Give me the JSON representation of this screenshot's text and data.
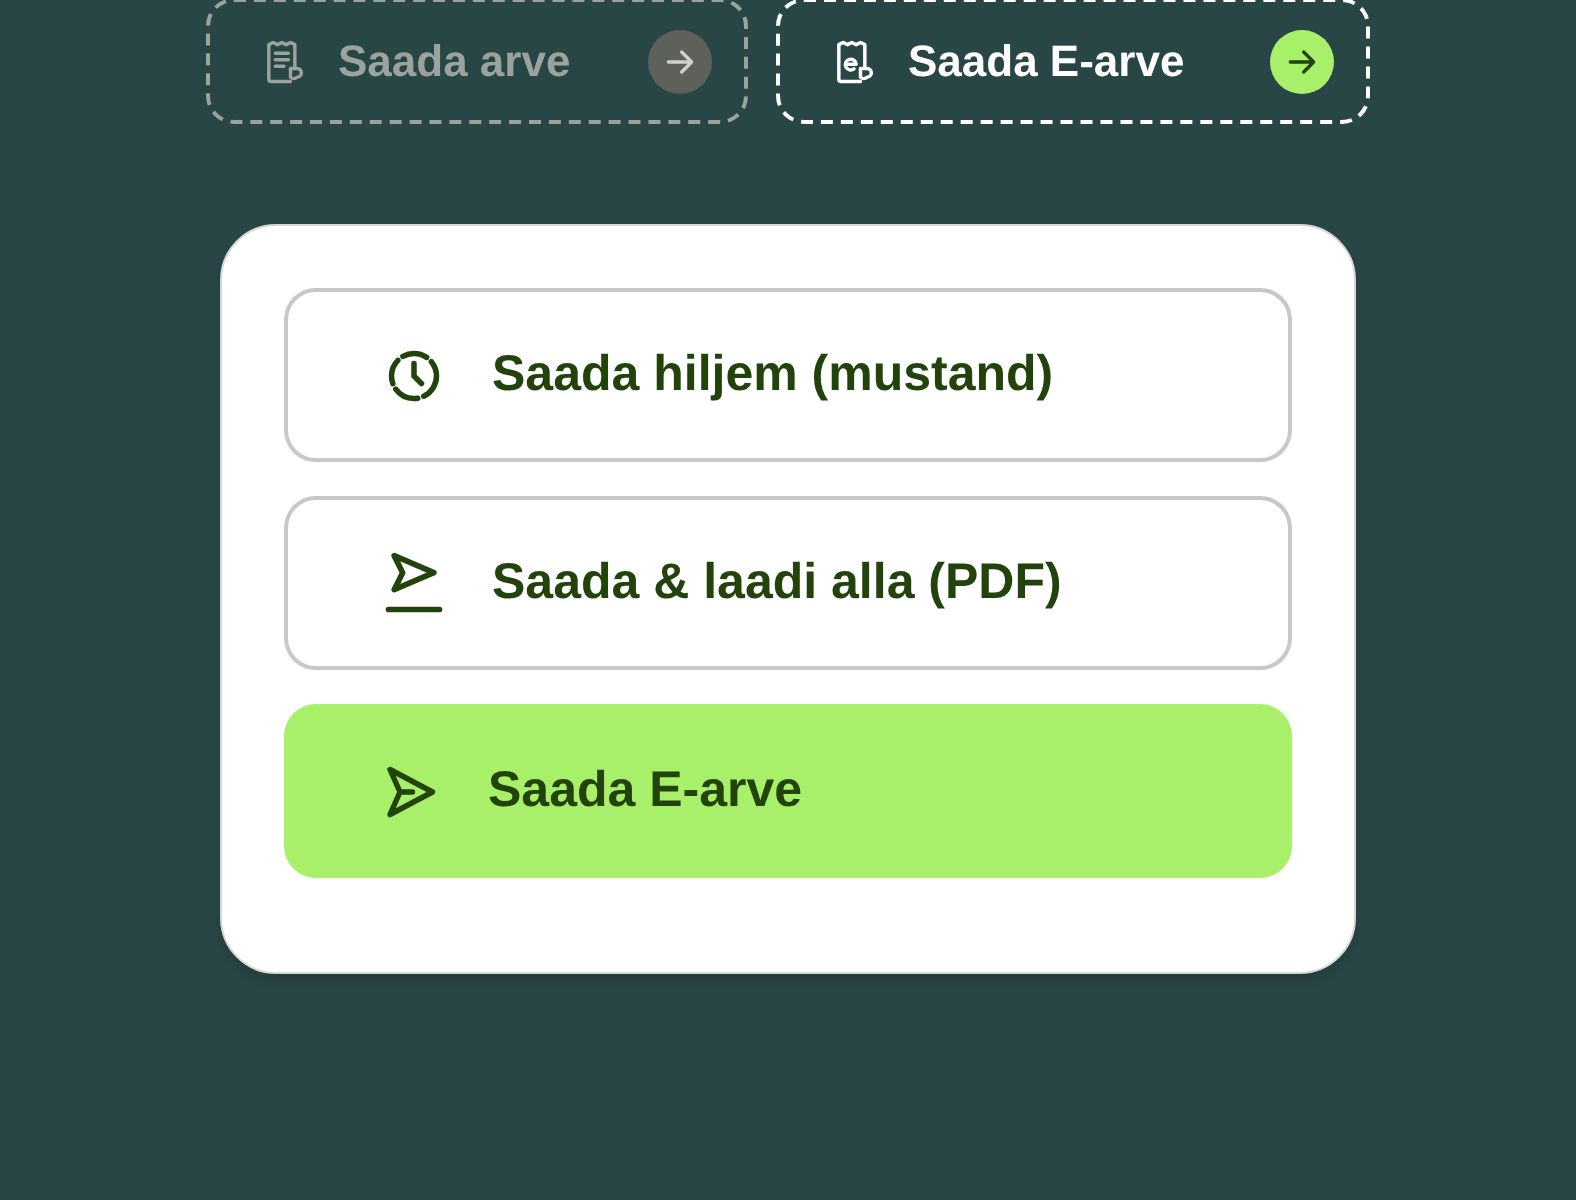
{
  "tabs": [
    {
      "label": "Saada arve",
      "kind": "invoice",
      "selected": false
    },
    {
      "label": "Saada E-arve",
      "kind": "e-invoice",
      "selected": true
    }
  ],
  "actions": [
    {
      "label": "Saada hiljem (mustand)",
      "kind": "schedule",
      "primary": false
    },
    {
      "label": "Saada & laadi alla (PDF)",
      "kind": "download",
      "primary": false
    },
    {
      "label": "Saada E-arve",
      "kind": "send",
      "primary": true
    }
  ]
}
